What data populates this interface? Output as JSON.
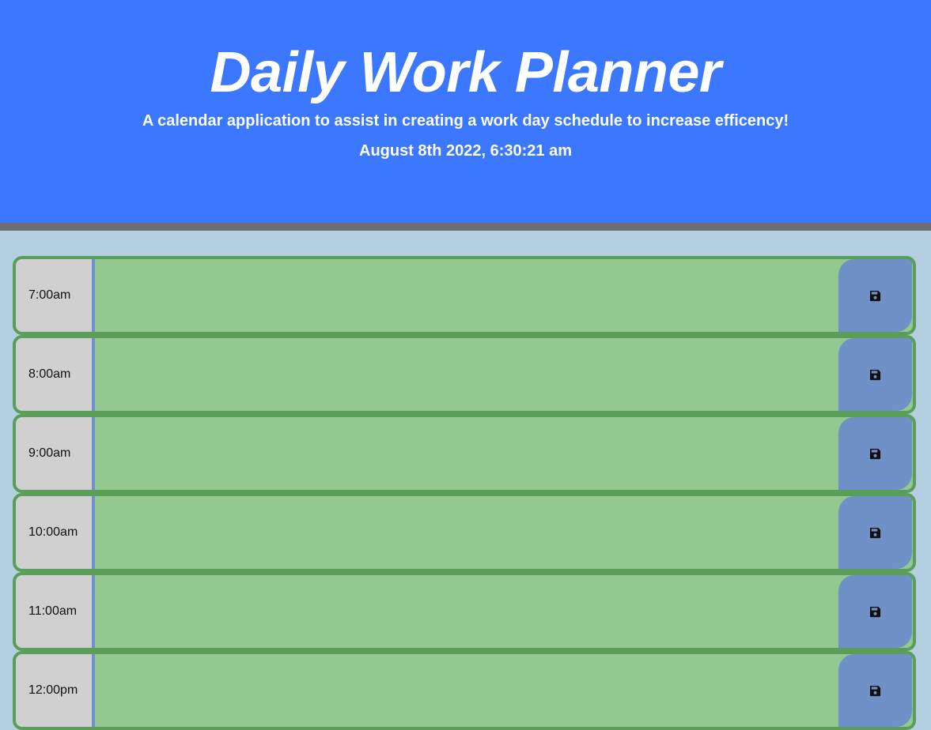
{
  "header": {
    "title": "Daily Work Planner",
    "subtitle": "A calendar application to assist in creating a work day schedule to increase efficency!",
    "current_day": "August 8th 2022, 6:30:21 am"
  },
  "time_blocks": [
    {
      "hour": "7:00am",
      "description": "",
      "save_icon": "floppy-disk-icon"
    },
    {
      "hour": "8:00am",
      "description": "",
      "save_icon": "floppy-disk-icon"
    },
    {
      "hour": "9:00am",
      "description": "",
      "save_icon": "floppy-disk-icon"
    },
    {
      "hour": "10:00am",
      "description": "",
      "save_icon": "floppy-disk-icon"
    },
    {
      "hour": "11:00am",
      "description": "",
      "save_icon": "floppy-disk-icon"
    },
    {
      "hour": "12:00pm",
      "description": "",
      "save_icon": "floppy-disk-icon"
    }
  ],
  "colors": {
    "header_bg": "#3b78ff",
    "page_bg": "#b3cfe1",
    "future_block": "#93c990",
    "block_border": "#5a9e5a",
    "hour_bg": "#d0d0d0",
    "save_button": "#7090c8"
  }
}
